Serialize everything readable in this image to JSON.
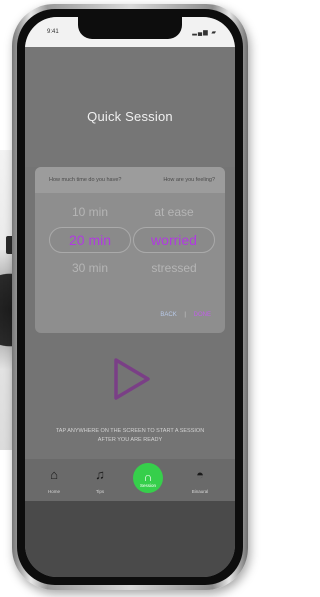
{
  "status_bar": {
    "time": "9:41",
    "icons": "▂▄▆ ▰"
  },
  "screen": {
    "title": "Quick Session"
  },
  "picker": {
    "left_header": "How much time do you have?",
    "right_header": "How are you feeling?",
    "duration_options": [
      "10 min",
      "20 min",
      "30 min"
    ],
    "duration_selected": "20 min",
    "mood_options": [
      "at ease",
      "worried",
      "stressed"
    ],
    "mood_selected": "worried",
    "back_label": "BACK",
    "done_label": "DONE"
  },
  "play": {
    "icon": "play-icon",
    "color": "#7a3f86"
  },
  "hint": {
    "line1": "TAP ANYWHERE ON THE SCREEN TO START A SESSION",
    "line2": "AFTER YOU ARE READY"
  },
  "tabbar": {
    "items": [
      {
        "label": "Home",
        "icon": "home-icon"
      },
      {
        "label": "Tips",
        "icon": "music-note-icon"
      },
      {
        "label": "Session",
        "icon": "headphones-icon",
        "active": true
      },
      {
        "label": "Binaural",
        "icon": "headphones-alt-icon"
      }
    ],
    "active_color": "#36cf4b"
  }
}
